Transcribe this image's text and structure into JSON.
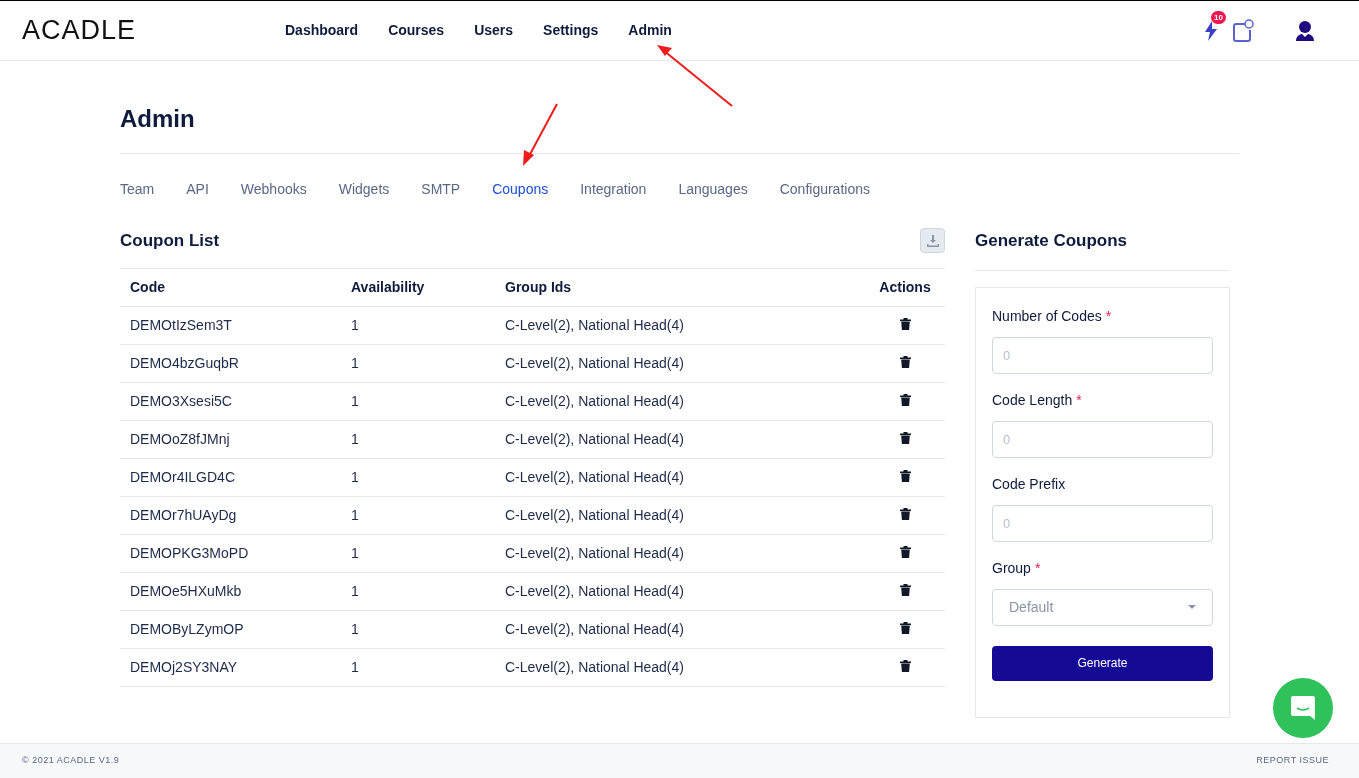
{
  "header": {
    "logo": "ACADLE",
    "nav": [
      {
        "label": "Dashboard",
        "selected": false
      },
      {
        "label": "Courses",
        "selected": false
      },
      {
        "label": "Users",
        "selected": false
      },
      {
        "label": "Settings",
        "selected": false
      },
      {
        "label": "Admin",
        "selected": false
      }
    ],
    "notification_count": "10"
  },
  "page": {
    "title": "Admin",
    "tabs": [
      {
        "label": "Team",
        "selected": false
      },
      {
        "label": "API",
        "selected": false
      },
      {
        "label": "Webhooks",
        "selected": false
      },
      {
        "label": "Widgets",
        "selected": false
      },
      {
        "label": "SMTP",
        "selected": false
      },
      {
        "label": "Coupons",
        "selected": true
      },
      {
        "label": "Integration",
        "selected": false
      },
      {
        "label": "Languages",
        "selected": false
      },
      {
        "label": "Configurations",
        "selected": false
      }
    ]
  },
  "coupon_list": {
    "title": "Coupon List",
    "columns": [
      "Code",
      "Availability",
      "Group Ids",
      "Actions"
    ],
    "rows": [
      {
        "code": "DEMOtIzSem3T",
        "availability": "1",
        "group_ids": "C-Level(2), National Head(4)"
      },
      {
        "code": "DEMO4bzGuqbR",
        "availability": "1",
        "group_ids": "C-Level(2), National Head(4)"
      },
      {
        "code": "DEMO3Xsesi5C",
        "availability": "1",
        "group_ids": "C-Level(2), National Head(4)"
      },
      {
        "code": "DEMOoZ8fJMnj",
        "availability": "1",
        "group_ids": "C-Level(2), National Head(4)"
      },
      {
        "code": "DEMOr4ILGD4C",
        "availability": "1",
        "group_ids": "C-Level(2), National Head(4)"
      },
      {
        "code": "DEMOr7hUAyDg",
        "availability": "1",
        "group_ids": "C-Level(2), National Head(4)"
      },
      {
        "code": "DEMOPKG3MoPD",
        "availability": "1",
        "group_ids": "C-Level(2), National Head(4)"
      },
      {
        "code": "DEMOe5HXuMkb",
        "availability": "1",
        "group_ids": "C-Level(2), National Head(4)"
      },
      {
        "code": "DEMOByLZymOP",
        "availability": "1",
        "group_ids": "C-Level(2), National Head(4)"
      },
      {
        "code": "DEMOj2SY3NAY",
        "availability": "1",
        "group_ids": "C-Level(2), National Head(4)"
      }
    ]
  },
  "generate": {
    "title": "Generate Coupons",
    "fields": [
      {
        "kind": "input",
        "label": "Number of Codes",
        "required_mark": "*",
        "placeholder": "0"
      },
      {
        "kind": "input",
        "label": "Code Length",
        "required_mark": "*",
        "placeholder": "0"
      },
      {
        "kind": "input",
        "label": "Code Prefix",
        "placeholder": "0"
      },
      {
        "kind": "select",
        "label": "Group",
        "required_mark": "*",
        "placeholder": "Default"
      }
    ],
    "button": "Generate"
  },
  "footer": {
    "copyright": "© 2021 ACADLE V1.9",
    "link": "REPORT ISSUE"
  }
}
